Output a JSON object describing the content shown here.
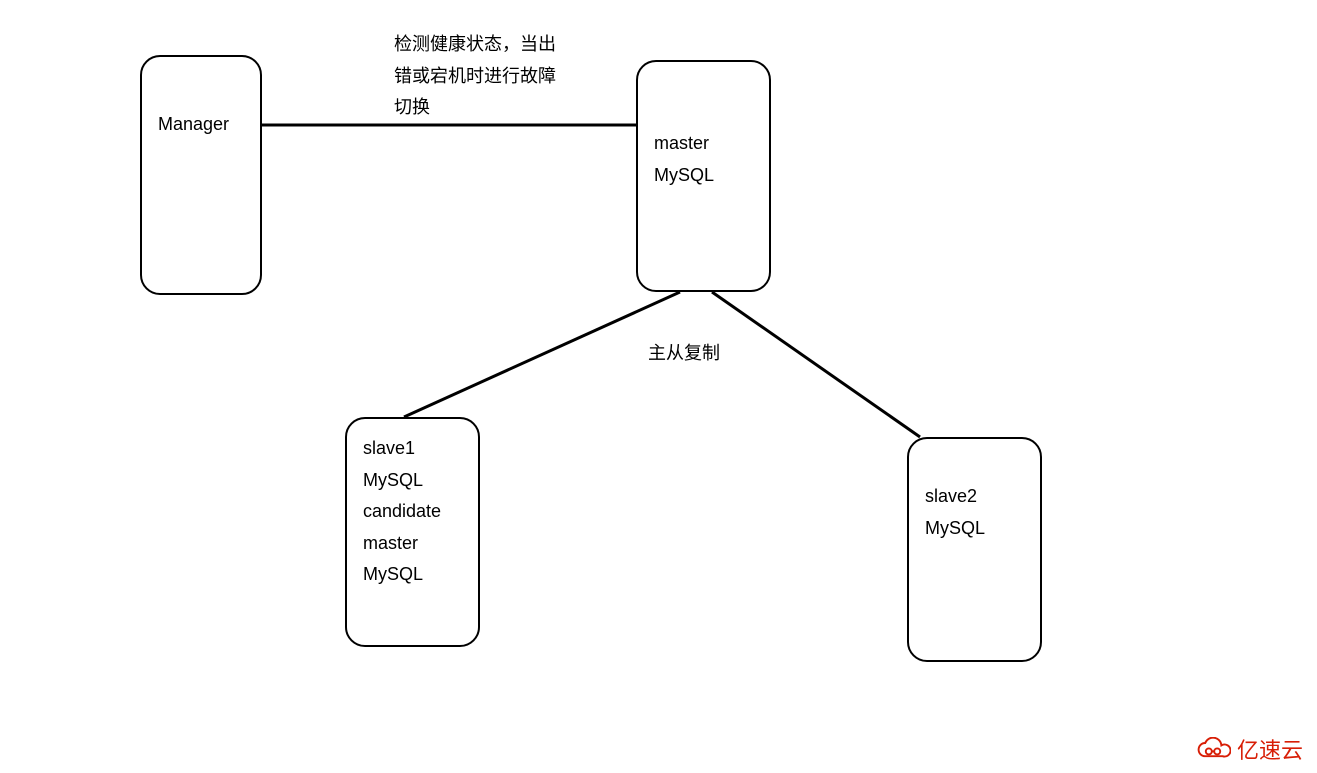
{
  "nodes": {
    "manager": {
      "line1": "Manager"
    },
    "master": {
      "line1": "master",
      "line2": "MySQL"
    },
    "slave1": {
      "line1": "slave1",
      "line2": "MySQL",
      "line3": "",
      "line4": "candidate",
      "line5": "master",
      "line6": "MySQL"
    },
    "slave2": {
      "line1": "slave2",
      "line2": "MySQL"
    }
  },
  "labels": {
    "healthcheck": "检测健康状态，当出\n错或宕机时进行故障\n切换",
    "replication": "主从复制"
  },
  "watermark": {
    "text": "亿速云"
  }
}
